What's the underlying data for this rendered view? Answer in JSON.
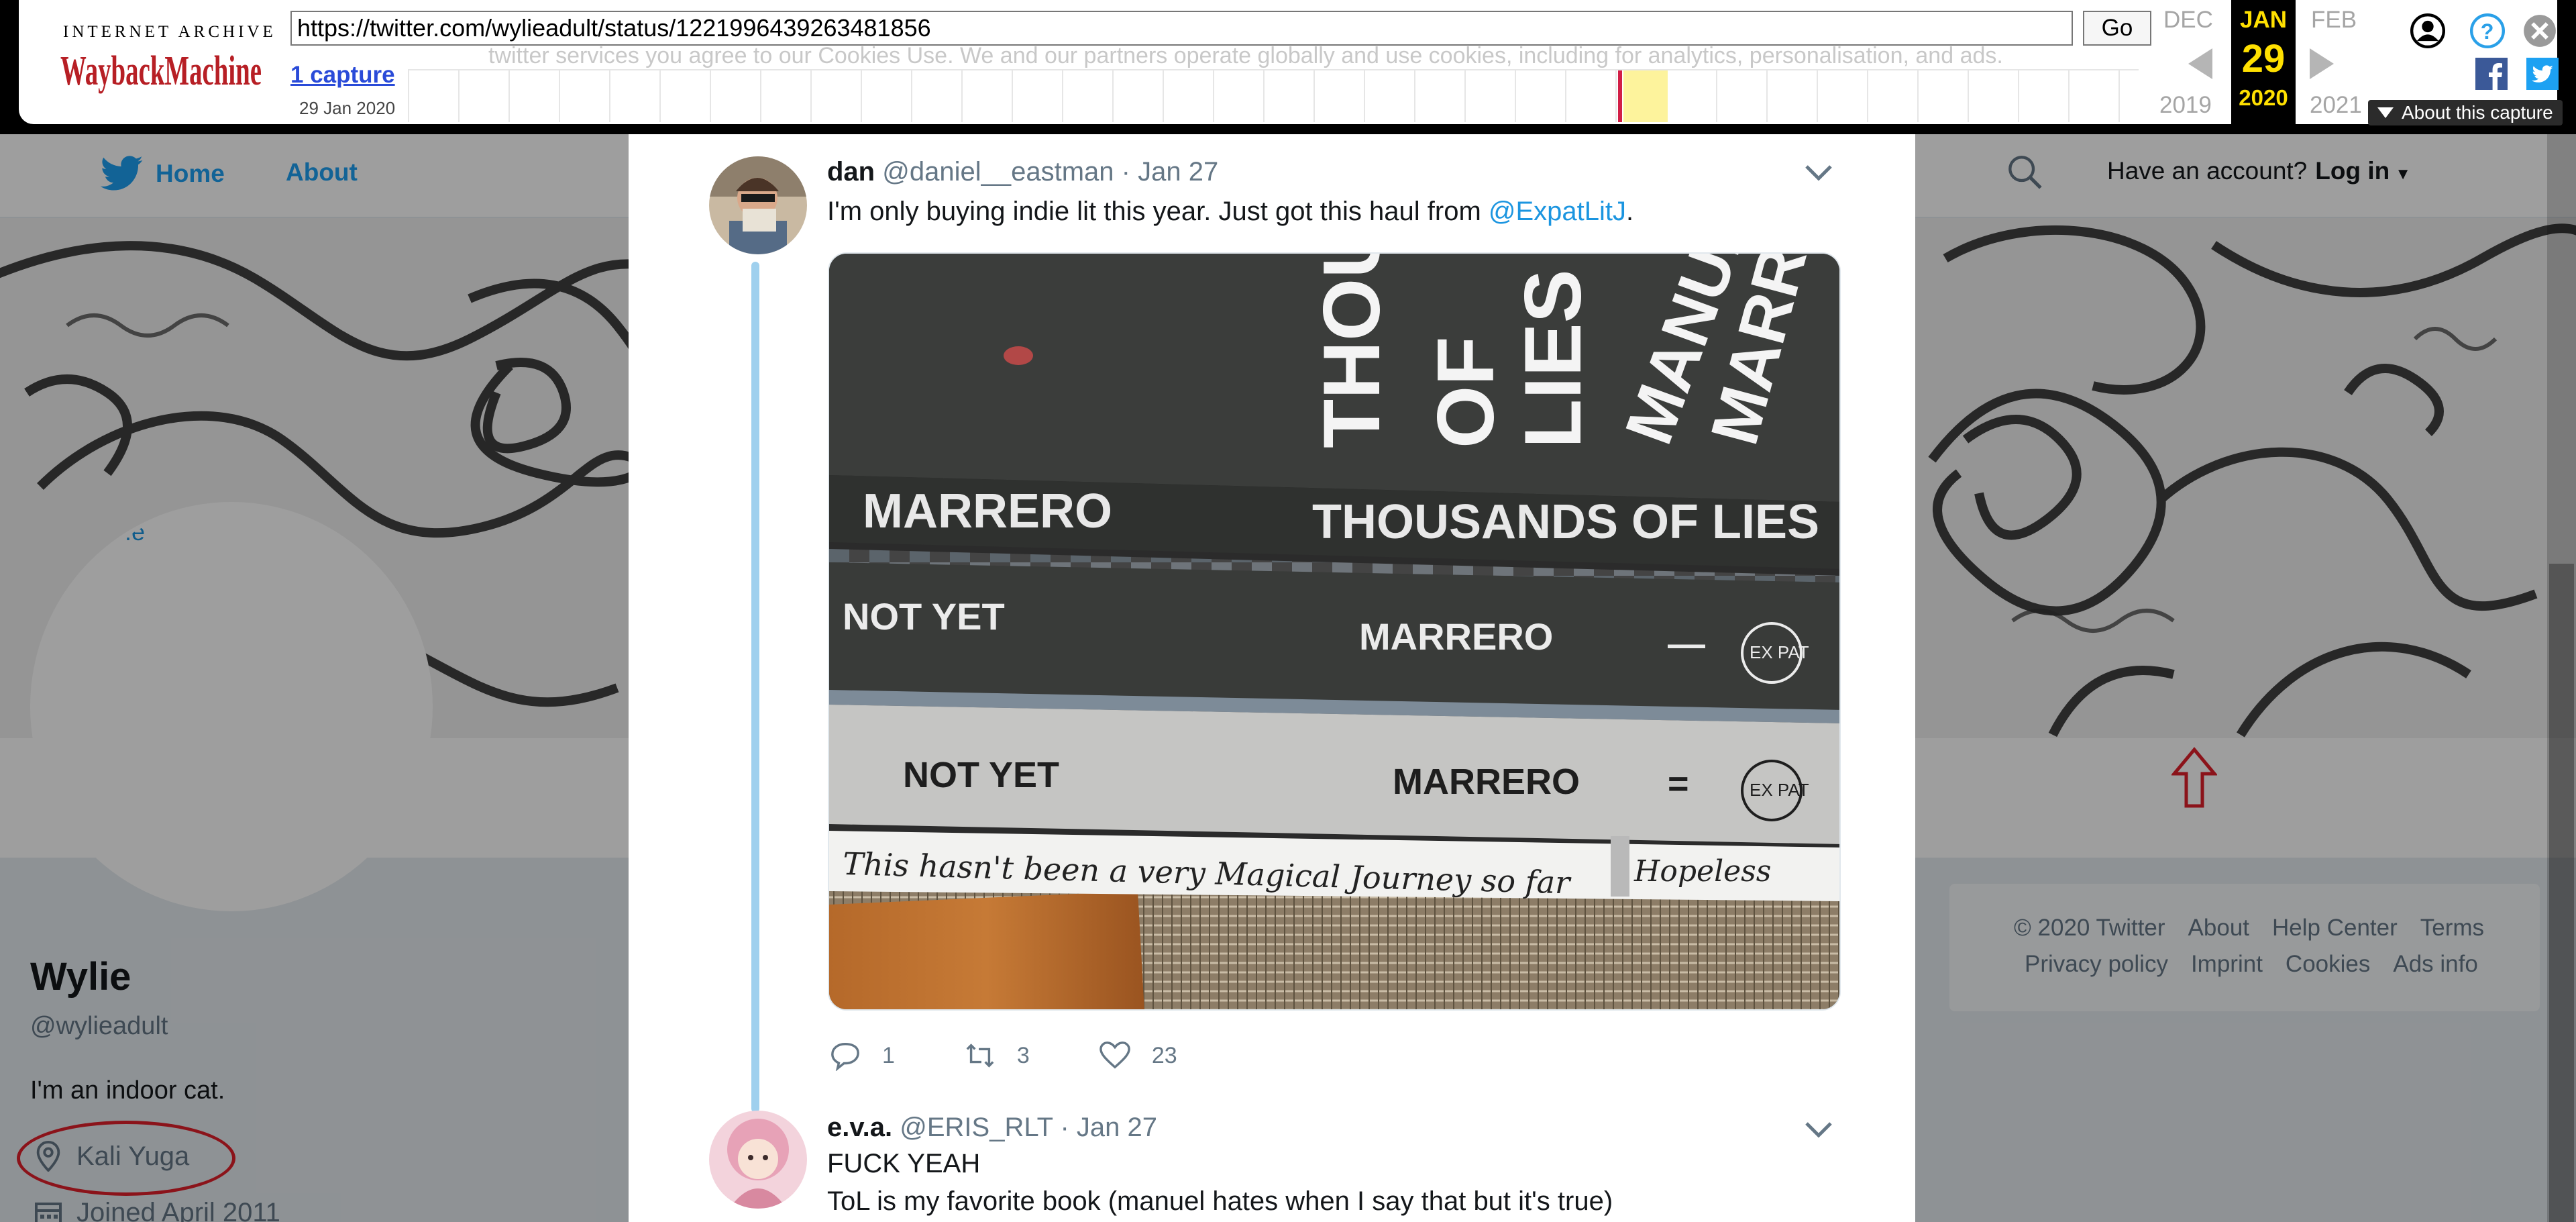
{
  "wayback": {
    "logo_top": "INTERNET ARCHIVE",
    "logo_main": "WaybackMachine",
    "url": "https://twitter.com/wylieadult/status/1221996439263481856",
    "go_label": "Go",
    "captures_link": "1 capture",
    "captures_date": "29 Jan 2020",
    "ghost_text": "twitter services you agree to our Cookies Use. We and our partners operate globally and use cookies, including for analytics, personalisation, and ads.",
    "prev_month": "DEC",
    "current_month": "JAN",
    "current_day": "29",
    "current_year": "2020",
    "next_month": "FEB",
    "prev_year": "2019",
    "next_year": "2021",
    "about_capture": "About this capture",
    "icons": [
      "user-icon",
      "help-icon",
      "close-icon",
      "facebook-icon",
      "twitter-icon"
    ]
  },
  "header": {
    "home_label": "Home",
    "about_label": "About",
    "account_prompt": "Have an account?",
    "login_label": "Log in"
  },
  "profile": {
    "name": "Wylie",
    "handle": "@wylieadult",
    "bio": "I'm an indoor cat.",
    "location": "Kali Yuga",
    "joined": "Joined April 2011",
    "avatar_fragment": ".e"
  },
  "footer": {
    "row1": [
      "© 2020 Twitter",
      "About",
      "Help Center",
      "Terms"
    ],
    "row2": [
      "Privacy policy",
      "Imprint",
      "Cookies",
      "Ads info"
    ]
  },
  "tweets": [
    {
      "name": "dan",
      "handle": "@daniel__eastman",
      "sep": "·",
      "date": "Jan 27",
      "text_before": "I'm only buying indie lit this year. Just got this haul from ",
      "mention": "@ExpatLitJ",
      "text_after": ".",
      "replies": "1",
      "retweets": "3",
      "likes": "23",
      "image": {
        "book1_cover_title_1": "THOUSANDS",
        "book1_cover_title_2": "OF",
        "book1_cover_title_3": "LIES",
        "book1_cover_author_1": "MANUEL",
        "book1_cover_author_2": "MARRERO",
        "book1_spine_author": "MARRERO",
        "book1_spine_title": "THOUSANDS OF LIES",
        "book2_spine_title": "NOT YET",
        "book2_spine_author": "MARRERO",
        "book2_mark": "—",
        "book2_logo": "EX PAT",
        "book3_spine_title": "NOT YET",
        "book3_spine_author": "MARRERO",
        "book3_mark": "=",
        "book3_logo": "EX PAT",
        "book4_spine_handwritten": "This hasn't been a very Magical Journey so far",
        "book4_spine_right": "Hopeless"
      }
    },
    {
      "name": "e.v.a.",
      "handle": "@ERIS_RLT",
      "sep": "·",
      "date": "Jan 27",
      "line1": "FUCK YEAH",
      "line2": "ToL is my favorite book (manuel hates when I say that but it's true)"
    }
  ],
  "colors": {
    "twitter_blue": "#1da1f2",
    "link_blue": "#1b95e0",
    "wayback_yellow": "#ffe000",
    "annotation_red": "#e0202a"
  }
}
